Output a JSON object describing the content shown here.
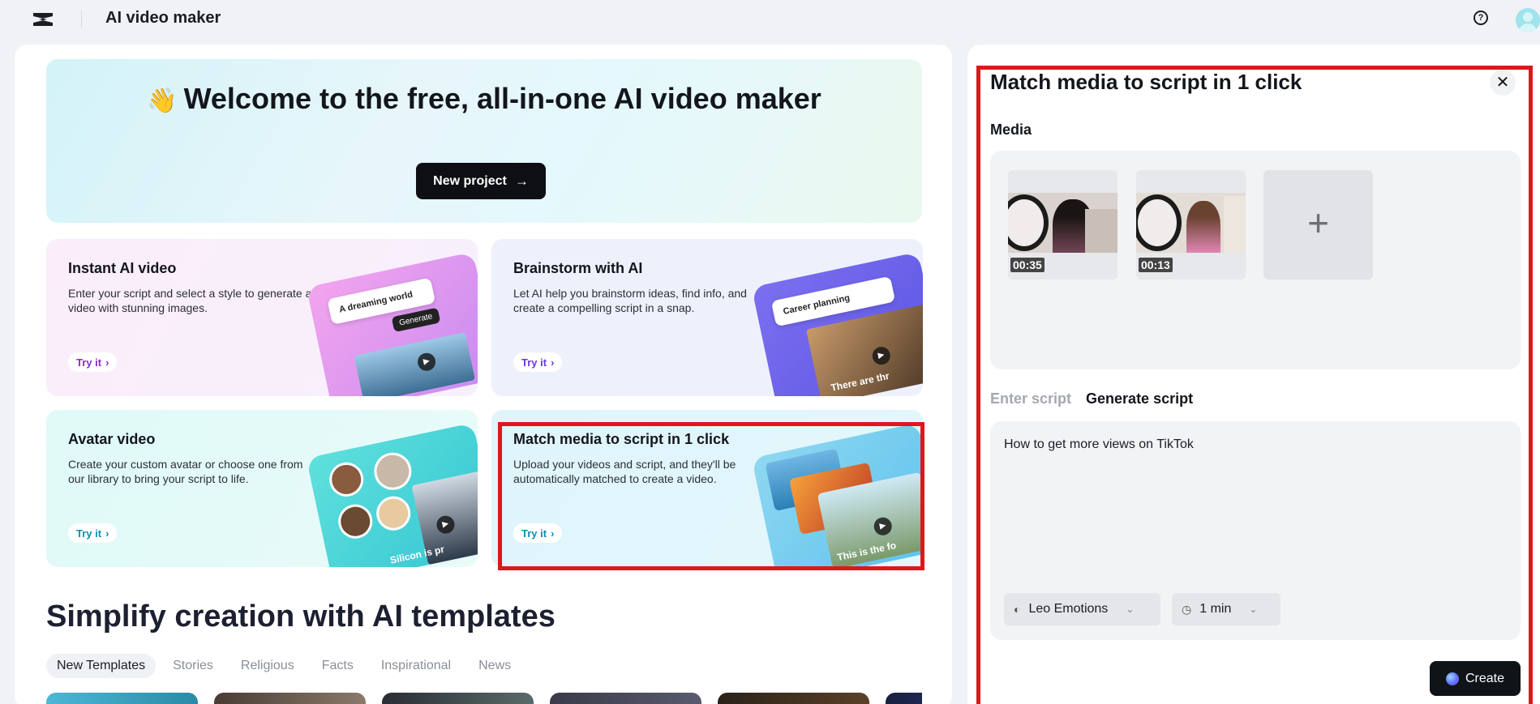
{
  "app": {
    "title": "AI video maker",
    "help_icon": "help-circle-icon",
    "logo_icon": "capcut-logo-icon"
  },
  "hero": {
    "emoji": "👋",
    "title": "Welcome to the free, all-in-one AI video maker",
    "new_project_label": "New project",
    "arrow_icon": "→"
  },
  "cards": [
    {
      "title": "Instant AI video",
      "description": "Enter your script and select a style to generate a video with stunning images.",
      "try_label": "Try it",
      "illus_text": "A dreaming world",
      "illus_button": "Generate"
    },
    {
      "title": "Brainstorm with AI",
      "description": "Let AI help you brainstorm ideas, find info, and create a compelling script in a snap.",
      "try_label": "Try it",
      "illus_text": "Career planning",
      "illus_caption": "There are thr"
    },
    {
      "title": "Avatar video",
      "description": "Create your custom avatar or choose one from our library to bring your script to life.",
      "try_label": "Try it",
      "illus_caption": "Silicon is pr"
    },
    {
      "title": "Match media to script in 1 click",
      "description": "Upload your videos and script, and they'll be automatically matched to create a video.",
      "try_label": "Try it",
      "illus_caption": "This is the fo"
    }
  ],
  "templates": {
    "section_title": "Simplify creation with AI templates",
    "tabs": [
      "New Templates",
      "Stories",
      "Religious",
      "Facts",
      "Inspirational",
      "News"
    ],
    "active_tab": "New Templates"
  },
  "panel": {
    "title": "Match media to script in 1 click",
    "close_icon": "✕",
    "media_label": "Media",
    "media": [
      {
        "duration": "00:35"
      },
      {
        "duration": "00:13"
      }
    ],
    "add_icon": "+",
    "script_tabs": [
      "Enter script",
      "Generate script"
    ],
    "active_script_tab": "Generate script",
    "script_text": "How to get more views on TikTok",
    "voice": "Leo Emotions",
    "duration": "1 min",
    "create_label": "Create"
  },
  "colors": {
    "highlight": "#e0161c",
    "primary_button": "#0d0f13"
  }
}
